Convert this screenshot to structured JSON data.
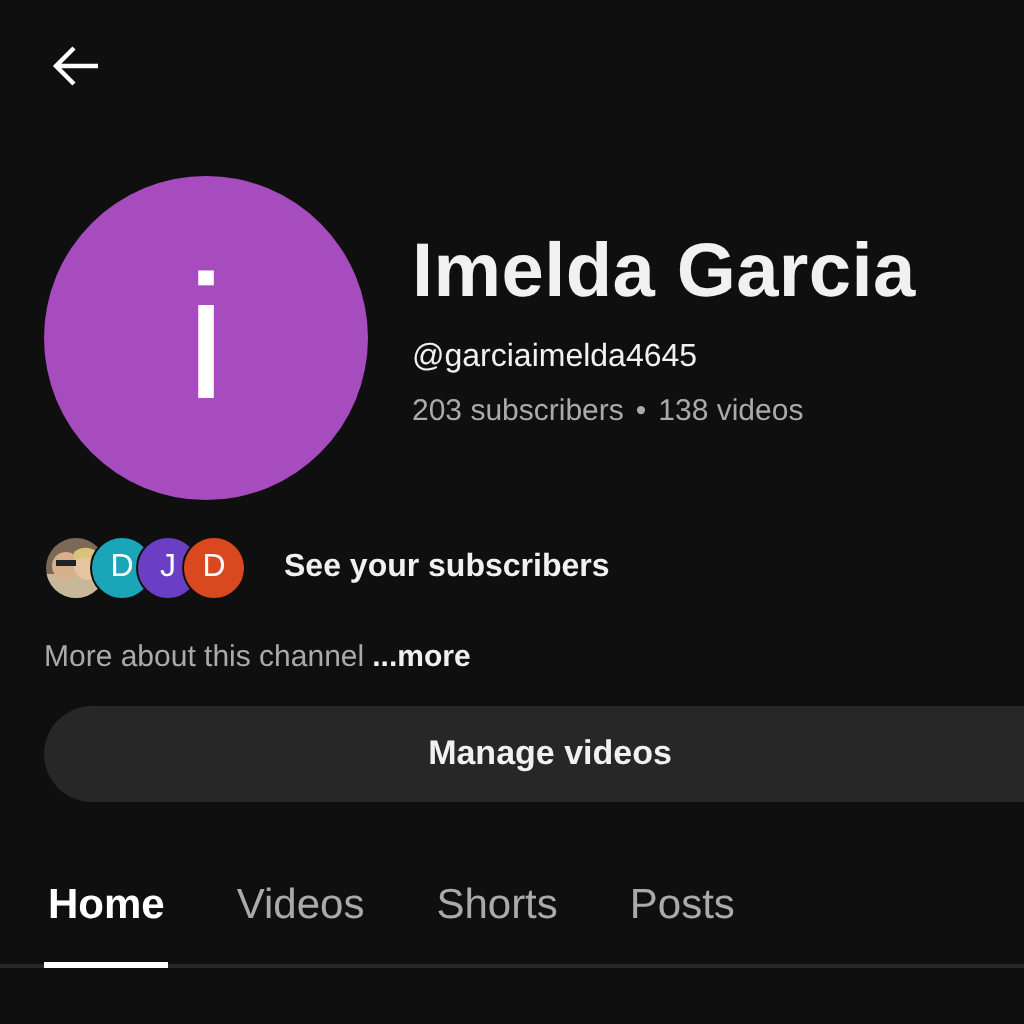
{
  "channel": {
    "avatar_letter": "i",
    "name": "Imelda Garcia",
    "handle": "@garciaimelda4645",
    "subscribers": "203 subscribers",
    "separator": "•",
    "videos": "138 videos"
  },
  "subscriber_avatars": [
    {
      "kind": "picture"
    },
    {
      "kind": "letter",
      "letter": "D",
      "color": "#1aa5b8"
    },
    {
      "kind": "letter",
      "letter": "J",
      "color": "#6a3fc4"
    },
    {
      "kind": "letter",
      "letter": "D",
      "color": "#d9481f"
    }
  ],
  "subscribers_link": "See your subscribers",
  "about": {
    "text": "More about this channel",
    "more": "...more"
  },
  "manage_button": "Manage videos",
  "tabs": [
    {
      "label": "Home",
      "selected": true
    },
    {
      "label": "Videos",
      "selected": false
    },
    {
      "label": "Shorts",
      "selected": false
    },
    {
      "label": "Posts",
      "selected": false
    }
  ]
}
